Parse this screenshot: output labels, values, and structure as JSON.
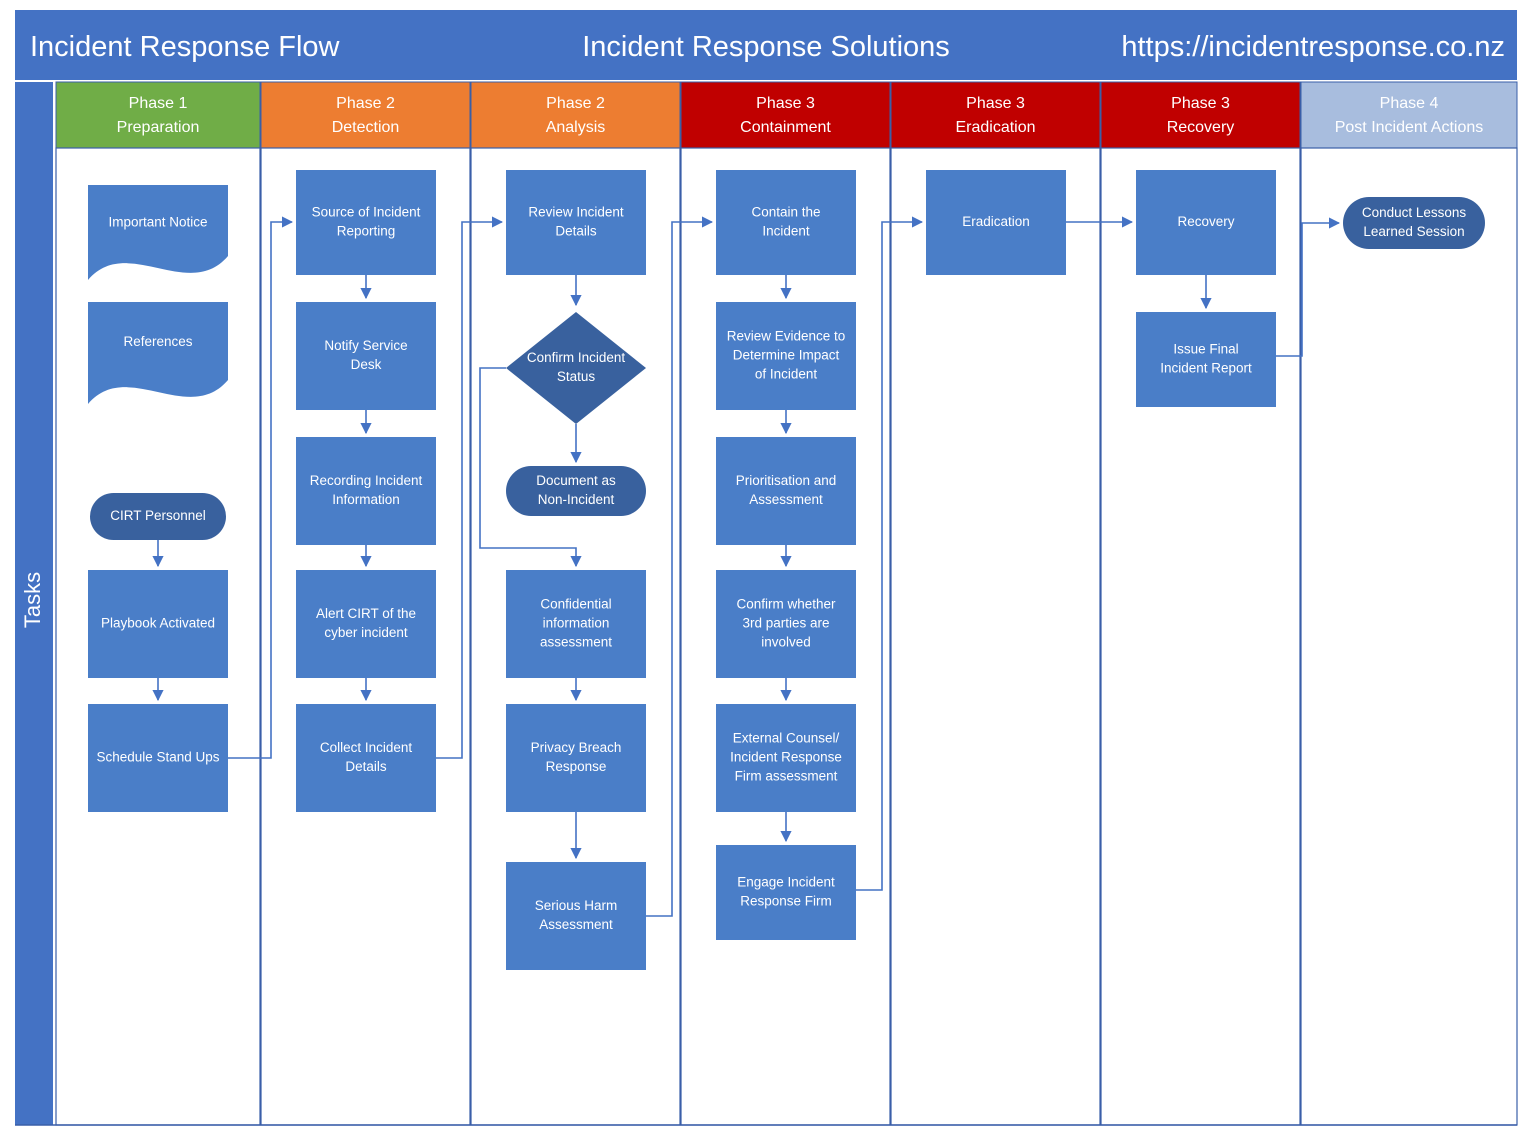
{
  "colors": {
    "banner": "#4472C4",
    "phase1": "#70AD47",
    "phase2": "#ED7D31",
    "phase3": "#C00000",
    "phase4": "#A8BDDE",
    "node_fill": "#4A7EC8",
    "node_dark": "#39619E",
    "connector": "#4472C4",
    "lane_border": "#3A5FA8",
    "page_bg": "#FFFFFF",
    "text_on_node": "#FFFFFF"
  },
  "header": {
    "left_title": "Incident Response Flow",
    "center_title": "Incident Response Solutions",
    "right_title": "https://incidentresponse.co.nz"
  },
  "lane_label": "Tasks",
  "phases": [
    {
      "name": "phase-1-preparation",
      "line1": "Phase 1",
      "line2": "Preparation",
      "color_key": "phase1"
    },
    {
      "name": "phase-2-detection",
      "line1": "Phase 2",
      "line2": "Detection",
      "color_key": "phase2"
    },
    {
      "name": "phase-2-analysis",
      "line1": "Phase 2",
      "line2": "Analysis",
      "color_key": "phase2"
    },
    {
      "name": "phase-3-containment",
      "line1": "Phase 3",
      "line2": "Containment",
      "color_key": "phase3"
    },
    {
      "name": "phase-3-eradication",
      "line1": "Phase 3",
      "line2": "Eradication",
      "color_key": "phase3"
    },
    {
      "name": "phase-3-recovery",
      "line1": "Phase 3",
      "line2": "Recovery",
      "color_key": "phase3"
    },
    {
      "name": "phase-4-post-incident",
      "line1": "Phase 4",
      "line2": "Post Incident Actions",
      "color_key": "phase4"
    }
  ],
  "nodes": {
    "important_notice": "Important Notice",
    "references": "References",
    "cirt_personnel": "CIRT Personnel",
    "playbook_activated": "Playbook Activated",
    "schedule_stand_ups": "Schedule Stand Ups",
    "source_of_incident_reporting": "Source of Incident Reporting",
    "notify_service_desk": "Notify Service Desk",
    "recording_incident_information": "Recording Incident Information",
    "alert_cirt": "Alert CIRT of the cyber incident",
    "collect_incident_details": "Collect Incident Details",
    "review_incident_details": "Review Incident Details",
    "confirm_incident_status": "Confirm Incident Status",
    "document_as_non_incident": "Document as Non-Incident",
    "confidential_information_assessment": "Confidential information assessment",
    "privacy_breach_response": "Privacy Breach Response",
    "serious_harm_assessment": "Serious Harm Assessment",
    "contain_the_incident": "Contain the Incident",
    "review_evidence": "Review Evidence to Determine Impact of Incident",
    "prioritisation_and_assessment": "Prioritisation and Assessment",
    "confirm_3rd_parties": "Confirm whether 3rd parties are involved",
    "external_counsel": "External Counsel/ Incident Response Firm assessment",
    "engage_incident_response_firm": "Engage Incident Response Firm",
    "eradication": "Eradication",
    "recovery": "Recovery",
    "issue_final_incident_report": "Issue Final Incident Report",
    "conduct_lessons_learned": "Conduct Lessons Learned Session"
  }
}
